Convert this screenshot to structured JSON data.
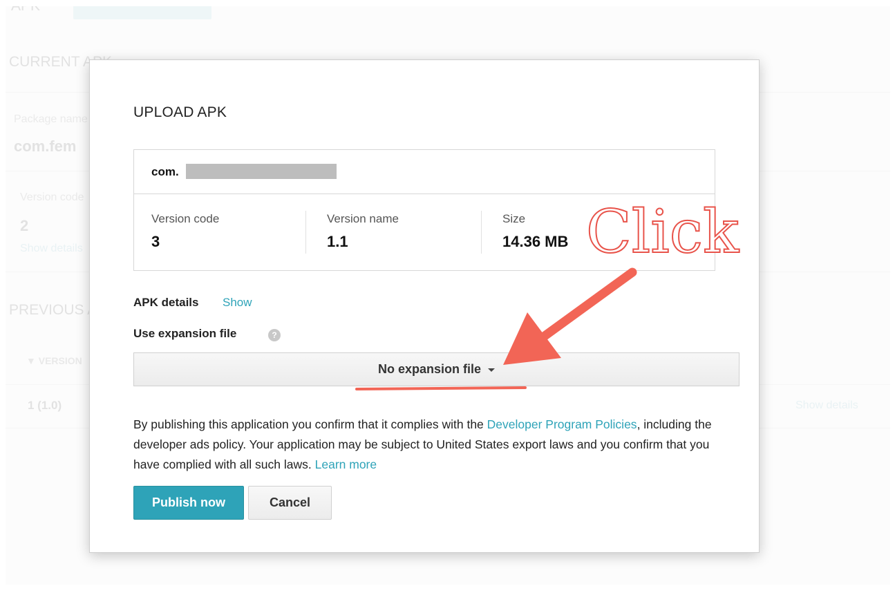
{
  "background": {
    "apk_heading": "APK",
    "current_apk": "CURRENT APK",
    "package_label": "Package name",
    "package_value": "com.fem",
    "version_code_label": "Version code",
    "version_code_value": "2",
    "show_details": "Show details",
    "previous": "PREVIOUS APKS",
    "version_column": "VERSION",
    "row_version": "1 (1.0)",
    "row_show_details": "Show details"
  },
  "dialog": {
    "title": "UPLOAD APK",
    "package_prefix": "com.",
    "version_code_label": "Version code",
    "version_code_value": "3",
    "version_name_label": "Version name",
    "version_name_value": "1.1",
    "size_label": "Size",
    "size_value": "14.36 MB",
    "apk_details_label": "APK details",
    "apk_details_link": "Show",
    "expansion_label": "Use expansion file",
    "expansion_help": "?",
    "expansion_selected": "No expansion file",
    "policy_prefix": "By publishing this application you confirm that it complies with the ",
    "policy_link": "Developer Program Policies",
    "policy_middle": ", including the developer ads policy. Your application may be subject to United States export laws and you confirm that you have complied with all such laws. ",
    "learn_more": "Learn more",
    "publish_button": "Publish now",
    "cancel_button": "Cancel"
  },
  "annotation": {
    "text": "Click",
    "color": "#e8534a"
  },
  "colors": {
    "accent": "#2ea3b8",
    "annotation": "#f26556"
  }
}
